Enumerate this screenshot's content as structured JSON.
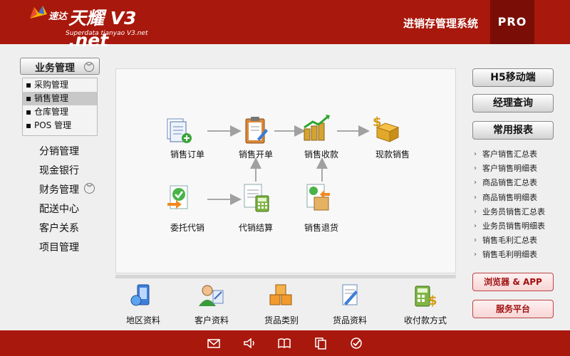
{
  "header": {
    "brand": "速达",
    "product": "天耀 V3 .net",
    "subtitle": "Superdata tianyao V3.net",
    "system_name": "进销存管理系统",
    "edition": "PRO"
  },
  "sidebar": {
    "business_button": "业务管理",
    "sub_items": [
      {
        "label": "采购管理"
      },
      {
        "label": "销售管理"
      },
      {
        "label": "仓库管理"
      },
      {
        "label": "POS 管理"
      }
    ],
    "selected_sub": "销售管理",
    "nav_items": [
      {
        "label": "分销管理"
      },
      {
        "label": "现金银行"
      },
      {
        "label": "财务管理"
      },
      {
        "label": "配送中心"
      },
      {
        "label": "客户关系"
      },
      {
        "label": "项目管理"
      }
    ]
  },
  "flow": {
    "sales_order": "销售订单",
    "sales_invoice": "销售开单",
    "sales_receipt": "销售收款",
    "cash_sale": "现款销售",
    "consignment": "委托代销",
    "consignment_settle": "代销结算",
    "sales_return": "销售退货"
  },
  "bottom": {
    "items": [
      {
        "label": "地区资料",
        "icon": "region-icon"
      },
      {
        "label": "客户资料",
        "icon": "customer-icon"
      },
      {
        "label": "货品类别",
        "icon": "goods-category-icon"
      },
      {
        "label": "货品资料",
        "icon": "goods-info-icon"
      },
      {
        "label": "收付款方式",
        "icon": "payment-method-icon"
      }
    ]
  },
  "right": {
    "buttons": [
      {
        "label": "H5移动端"
      },
      {
        "label": "经理查询"
      },
      {
        "label": "常用报表"
      }
    ],
    "reports": [
      {
        "label": "客户销售汇总表"
      },
      {
        "label": "客户销售明细表"
      },
      {
        "label": "商品销售汇总表"
      },
      {
        "label": "商品销售明细表"
      },
      {
        "label": "业务员销售汇总表"
      },
      {
        "label": "业务员销售明细表"
      },
      {
        "label": "销售毛利汇总表"
      },
      {
        "label": "销售毛利明细表"
      }
    ],
    "browser_app": "浏览器 & APP",
    "service_platform": "服务平台"
  },
  "footer": {
    "icons": [
      "mail-icon",
      "speaker-icon",
      "book-icon",
      "documents-icon",
      "check-icon"
    ]
  },
  "colors": {
    "header_red": "#a8180c",
    "pro_dark": "#7a0e07",
    "pink_button": "#f7d5d5"
  }
}
